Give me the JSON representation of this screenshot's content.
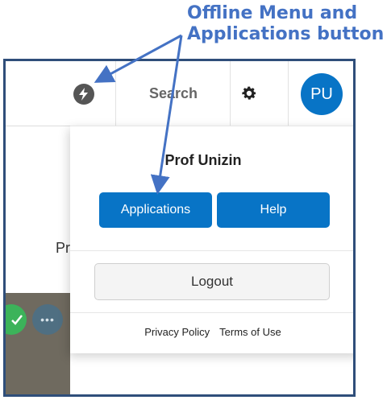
{
  "annotation": {
    "line1": "Offline Menu and",
    "line2": "Applications button",
    "color": "#4472c4"
  },
  "topbar": {
    "offline_icon": "lightning-bolt-icon",
    "search_label": "Search",
    "settings_icon": "gear-icon",
    "avatar_initials": "PU"
  },
  "background": {
    "partial_text": "Pr",
    "tile_icons": [
      "check-icon",
      "more-icon"
    ]
  },
  "menu": {
    "user_name": "Prof Unizin",
    "applications_label": "Applications",
    "help_label": "Help",
    "logout_label": "Logout",
    "privacy_label": "Privacy Policy",
    "terms_label": "Terms of Use"
  },
  "colors": {
    "primary": "#0874c6",
    "frame": "#2f4e7a"
  }
}
